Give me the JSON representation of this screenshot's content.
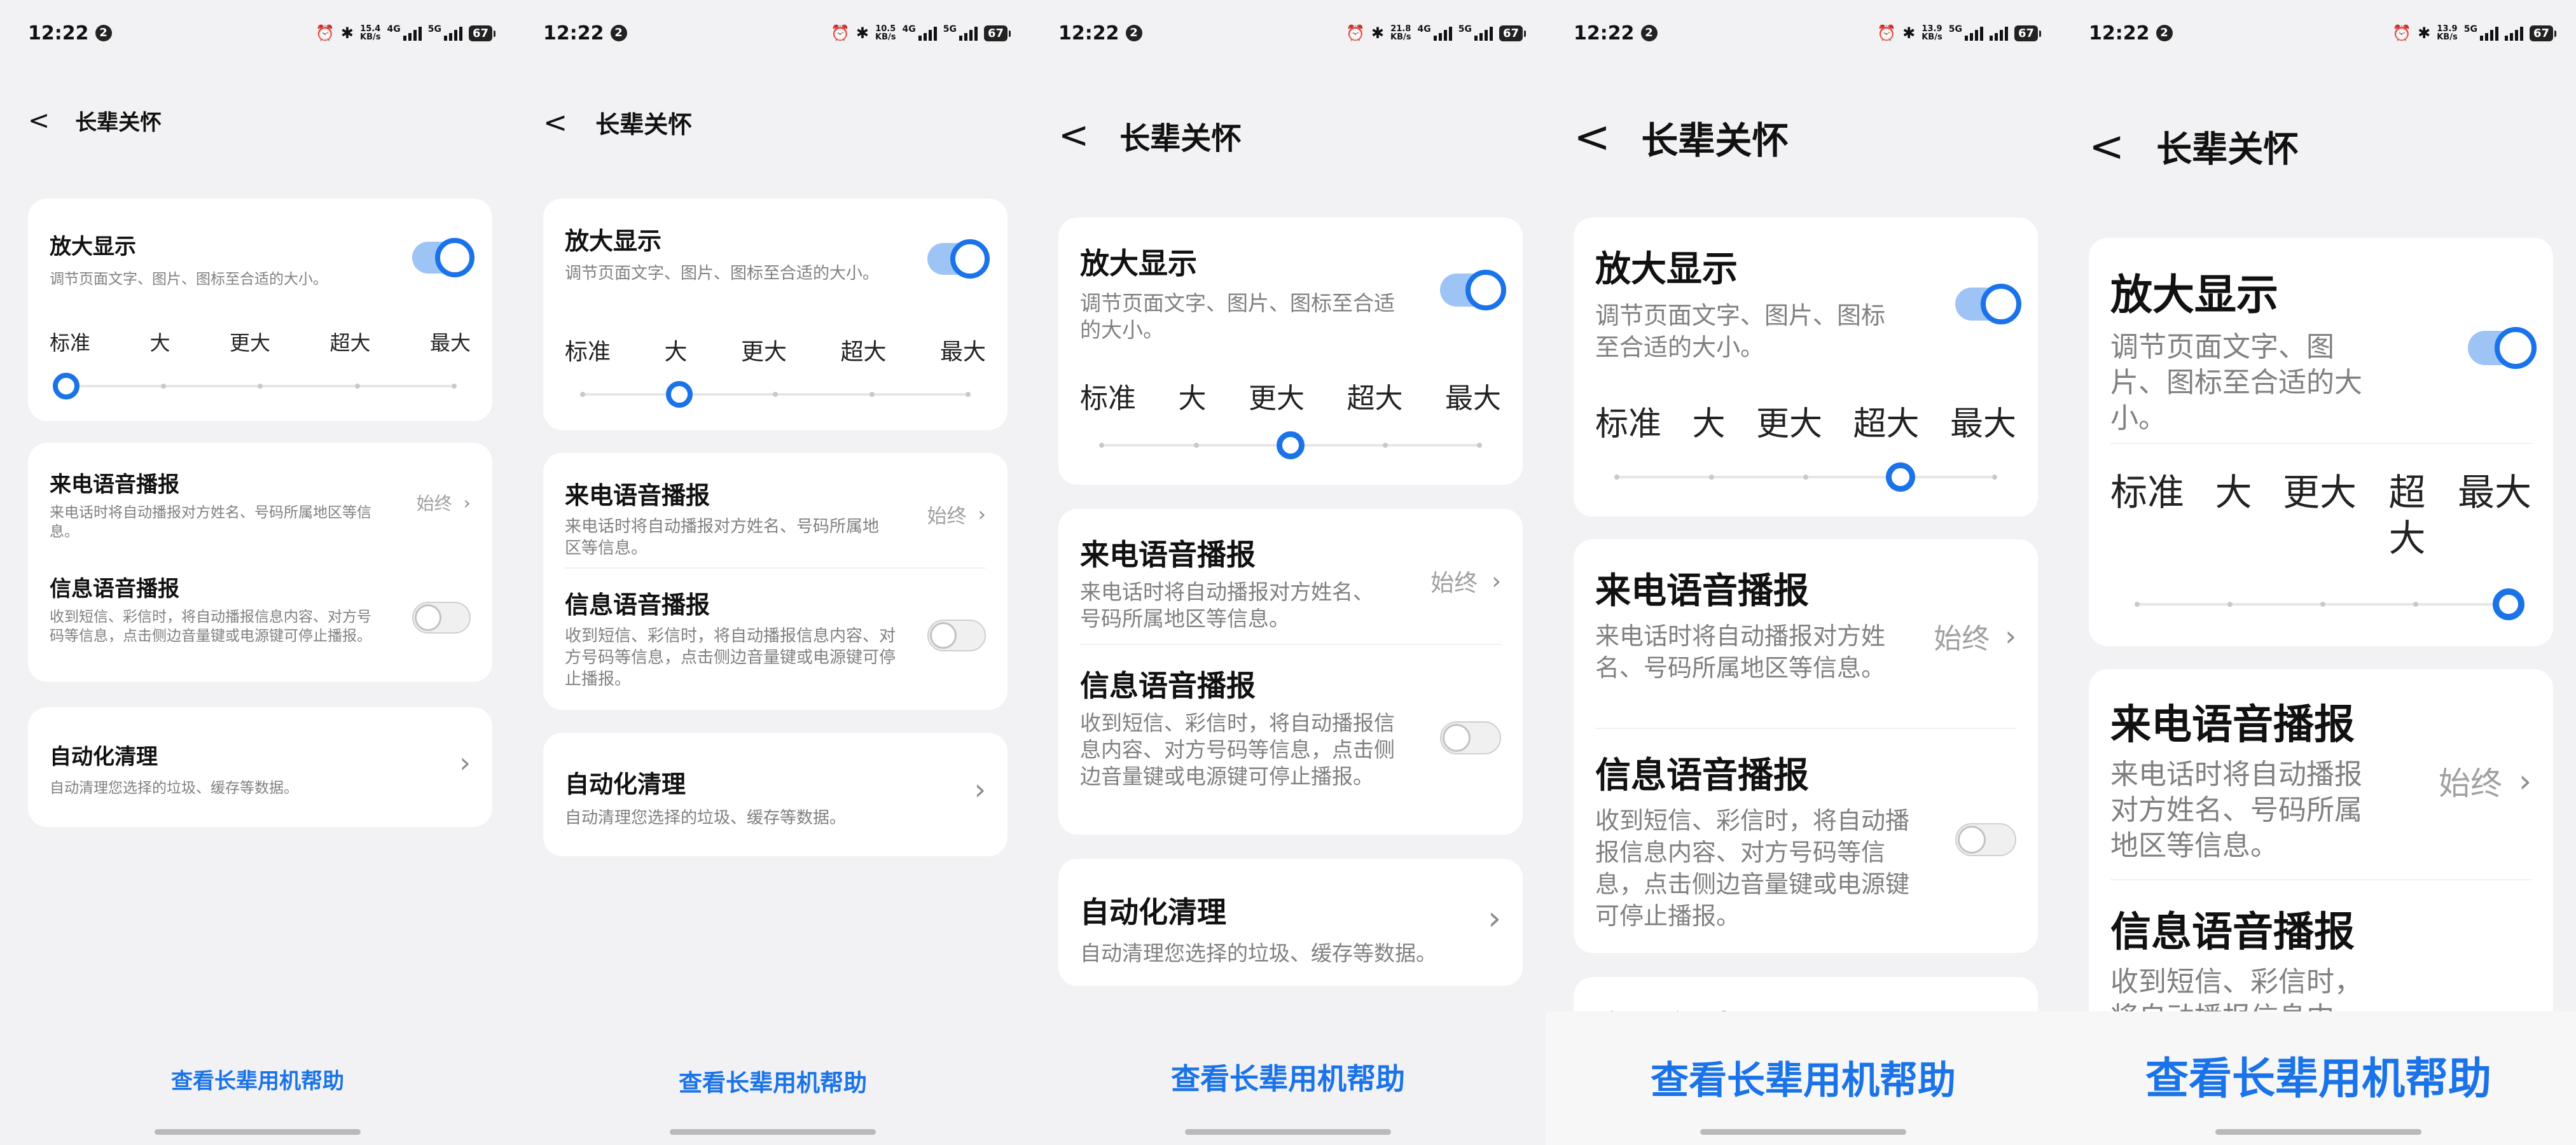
{
  "status": {
    "time": "12:22",
    "notif": "2",
    "battery": "67",
    "gen": "4G",
    "gen2": "5G",
    "speeds": [
      {
        "value": "15.4",
        "unit": "KB/s"
      },
      {
        "value": "10.5",
        "unit": "KB/s"
      },
      {
        "value": "21.8",
        "unit": "KB/s"
      },
      {
        "value": "13.9",
        "unit": "KB/s"
      },
      {
        "value": "13.9",
        "unit": "KB/s"
      }
    ]
  },
  "page": {
    "title": "长辈关怀",
    "back_icon": "chevron-left-icon"
  },
  "magnify": {
    "title": "放大显示",
    "desc": "调节页面文字、图片、图标至合适的大小。",
    "enabled": true,
    "levels": [
      "标准",
      "大",
      "更大",
      "超大",
      "最大"
    ],
    "selected_by_screen": [
      0,
      1,
      2,
      3,
      4
    ]
  },
  "call_broadcast": {
    "title": "来电语音播报",
    "desc": "来电话时将自动播报对方姓名、号码所属地区等信息。",
    "value": "始终"
  },
  "msg_broadcast": {
    "title": "信息语音播报",
    "desc": "收到短信、彩信时，将自动播报信息内容、对方号码等信息，点击侧边音量键或电源键可停止播报。",
    "enabled": false
  },
  "auto_clean": {
    "title": "自动化清理",
    "desc": "自动清理您选择的垃圾、缓存等数据。"
  },
  "help_link": "查看长辈用机帮助",
  "colors": {
    "accent": "#1a73e8",
    "background": "#f2f2f4",
    "card": "#ffffff"
  }
}
